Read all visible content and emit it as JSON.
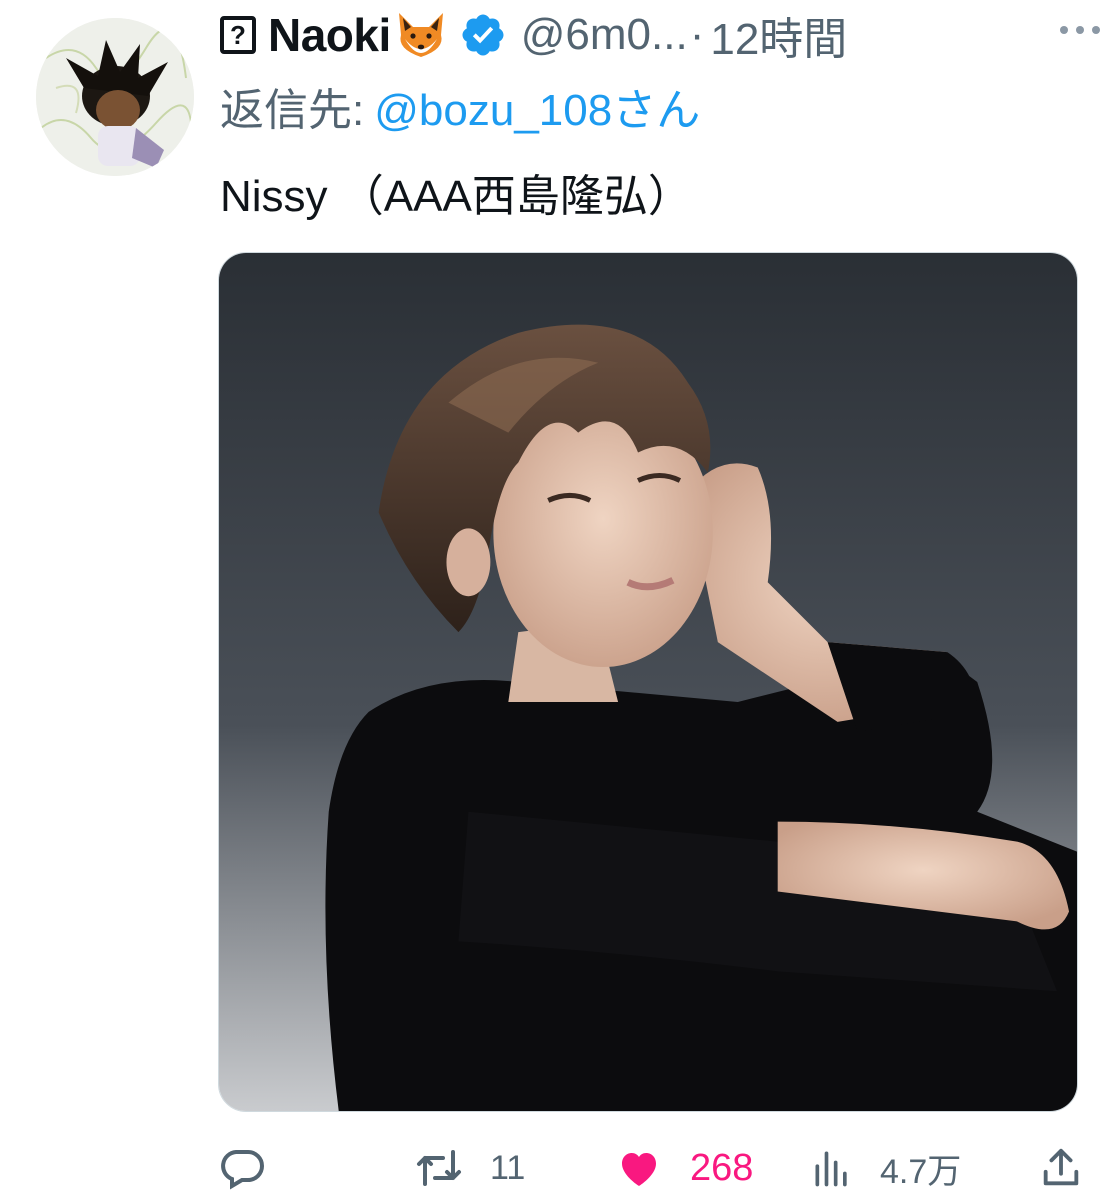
{
  "tweet": {
    "unknown_glyph": "?",
    "display_name": "Naoki",
    "handle": "@6m0...",
    "separator": "·",
    "time": "12時間",
    "reply_prefix": "返信先:",
    "reply_handle": "@bozu_108さん",
    "text": "Nissy （AAA西島隆弘）"
  },
  "actions": {
    "reply_count": "",
    "retweet_count": "11",
    "like_count": "268",
    "views_count": "4.7万"
  },
  "icons": {
    "avatar": "anime-character-avatar",
    "name_emoji": "fox-emoji",
    "badge": "verified-badge-icon",
    "more": "more-options-icon",
    "reply": "reply-icon",
    "retweet": "retweet-icon",
    "like": "heart-filled-icon",
    "views": "analytics-icon",
    "share": "share-icon"
  },
  "colors": {
    "verified": "#1d9bf0",
    "link": "#1d9bf0",
    "like": "#f91880",
    "secondary_text": "#536471"
  }
}
